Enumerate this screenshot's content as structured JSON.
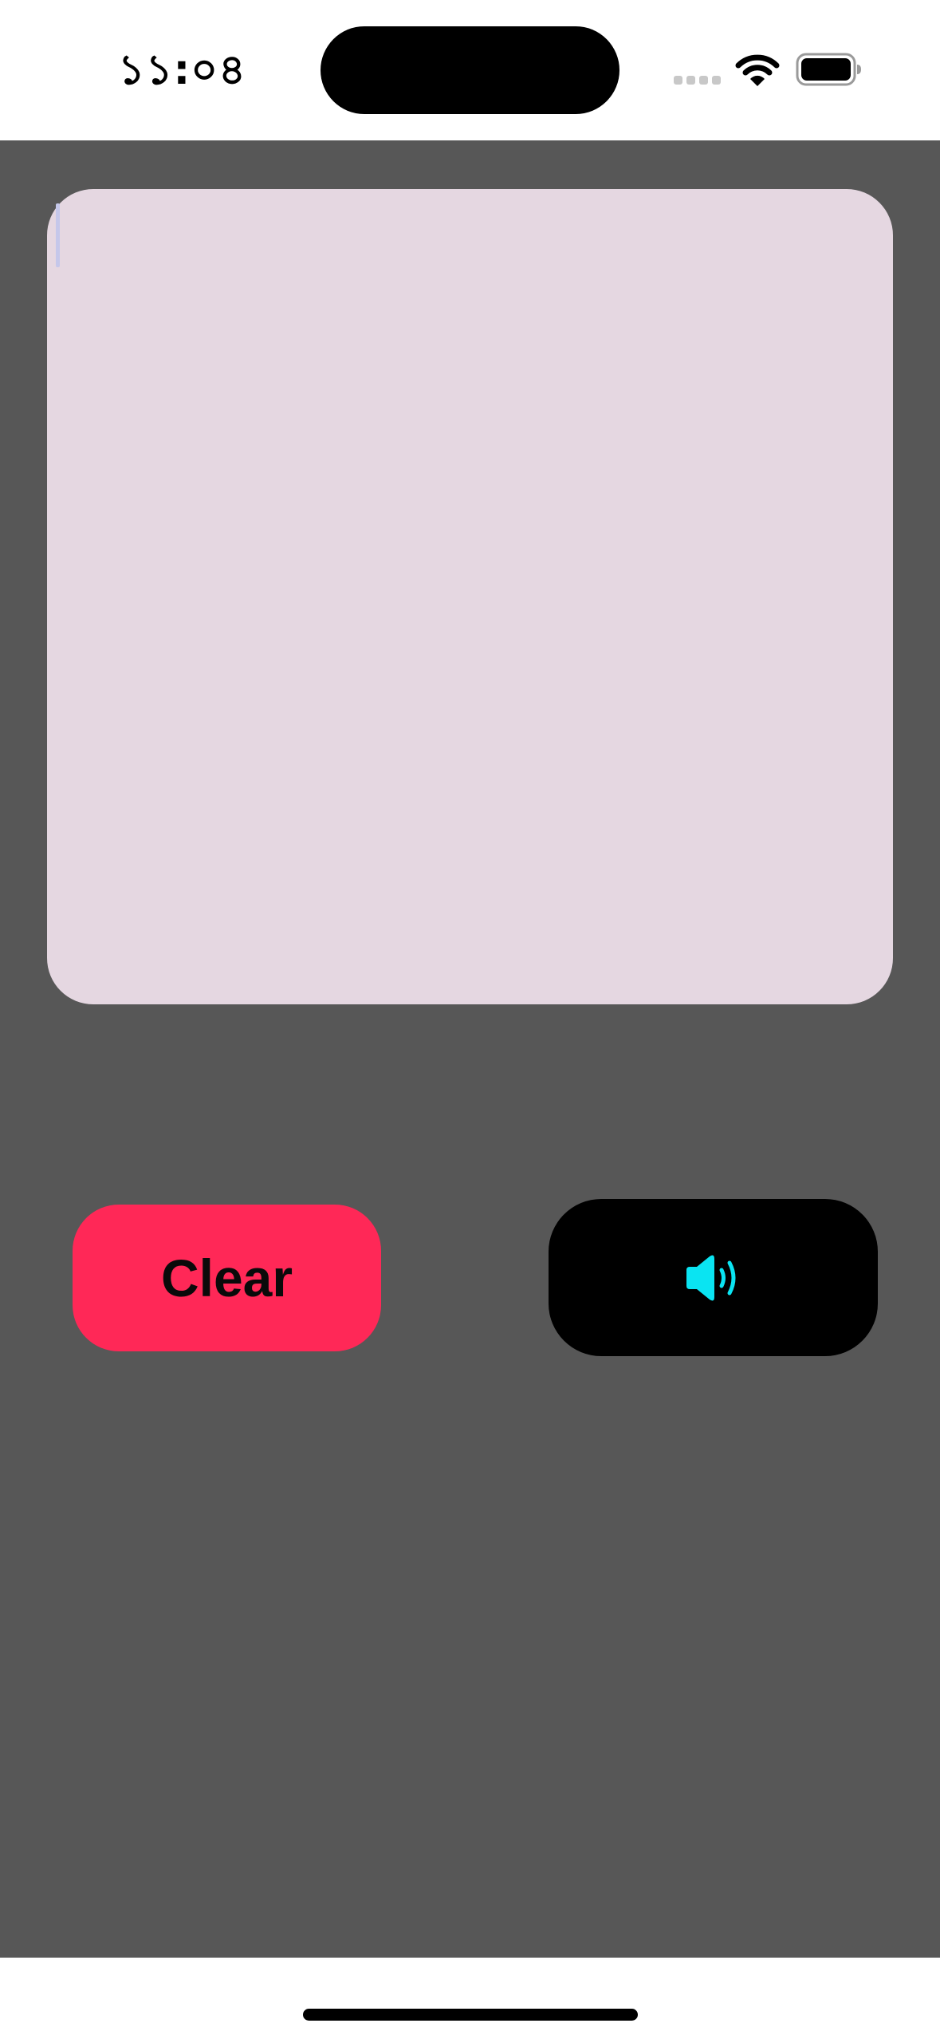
{
  "status_bar": {
    "time": "১১:০৪",
    "icons": [
      "cellular-signal-icon",
      "wifi-icon",
      "battery-icon"
    ]
  },
  "text_area": {
    "value": ""
  },
  "actions": {
    "clear_label": "Clear",
    "speak_icon": "speaker-icon"
  },
  "colors": {
    "background": "#575757",
    "text_area": "#e5d7e1",
    "clear_button": "#ff2857",
    "speak_button": "#000000",
    "speaker_icon": "#0ae4f2"
  }
}
